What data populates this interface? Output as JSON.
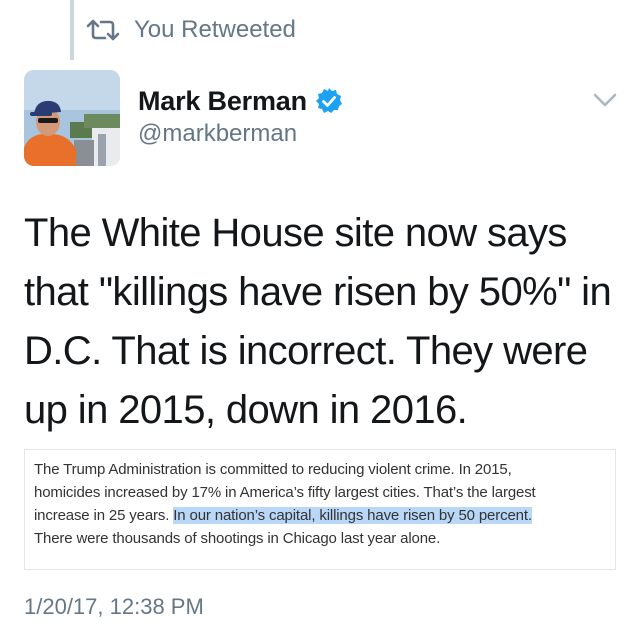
{
  "retweet": {
    "icon": "retweet-icon",
    "label": "You Retweeted"
  },
  "author": {
    "avatar_icon": "profile-photo",
    "name": "Mark Berman",
    "verified_icon": "verified-badge-icon",
    "handle": "@markberman"
  },
  "menu": {
    "icon": "chevron-down-icon"
  },
  "tweet": {
    "lines": [
      "The White House site now says",
      "that \"killings have risen by 50%\" in",
      "D.C. That is incorrect. They were",
      "up in 2015, down in 2016."
    ]
  },
  "quote_image": {
    "line1": "The Trump Administration is committed to reducing violent crime. In 2015,",
    "line2": "homicides increased by 17% in America’s fifty largest cities. That’s the largest",
    "line3_plain": "increase in 25 years. ",
    "line3_highlight": "In our nation’s capital, killings have risen by 50 percent.",
    "line4": "There were thousands of shootings in Chicago last year alone."
  },
  "timestamp": "1/20/17, 12:38 PM",
  "colors": {
    "accent": "#1da1f2",
    "muted": "#657786",
    "highlight": "#b9d7f6"
  }
}
